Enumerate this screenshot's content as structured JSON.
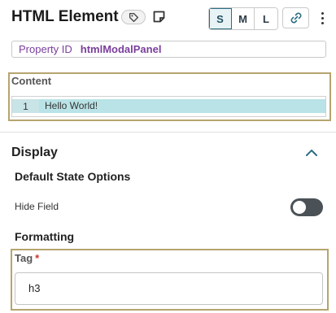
{
  "header": {
    "title": "HTML Element",
    "size_options": [
      "S",
      "M",
      "L"
    ],
    "active_size": "S",
    "icons": [
      "tag-icon",
      "note-icon",
      "link-icon",
      "more-vertical-icon"
    ]
  },
  "property": {
    "label": "Property ID",
    "value": "htmlModalPanel"
  },
  "content": {
    "label": "Content",
    "lines": [
      {
        "number": "1",
        "text": "Hello World!"
      }
    ]
  },
  "display": {
    "title": "Display",
    "default_state_heading": "Default State Options",
    "hide_field_label": "Hide Field",
    "hide_field_enabled": false,
    "formatting_heading": "Formatting",
    "tag_label": "Tag",
    "tag_required_mark": "*",
    "tag_value": "h3"
  },
  "colors": {
    "accent": "#2a6e82",
    "highlight_frame": "#b5a56e",
    "property_text": "#7a3e9d",
    "code_highlight": "#b9e3e6",
    "required": "#d0342c"
  }
}
